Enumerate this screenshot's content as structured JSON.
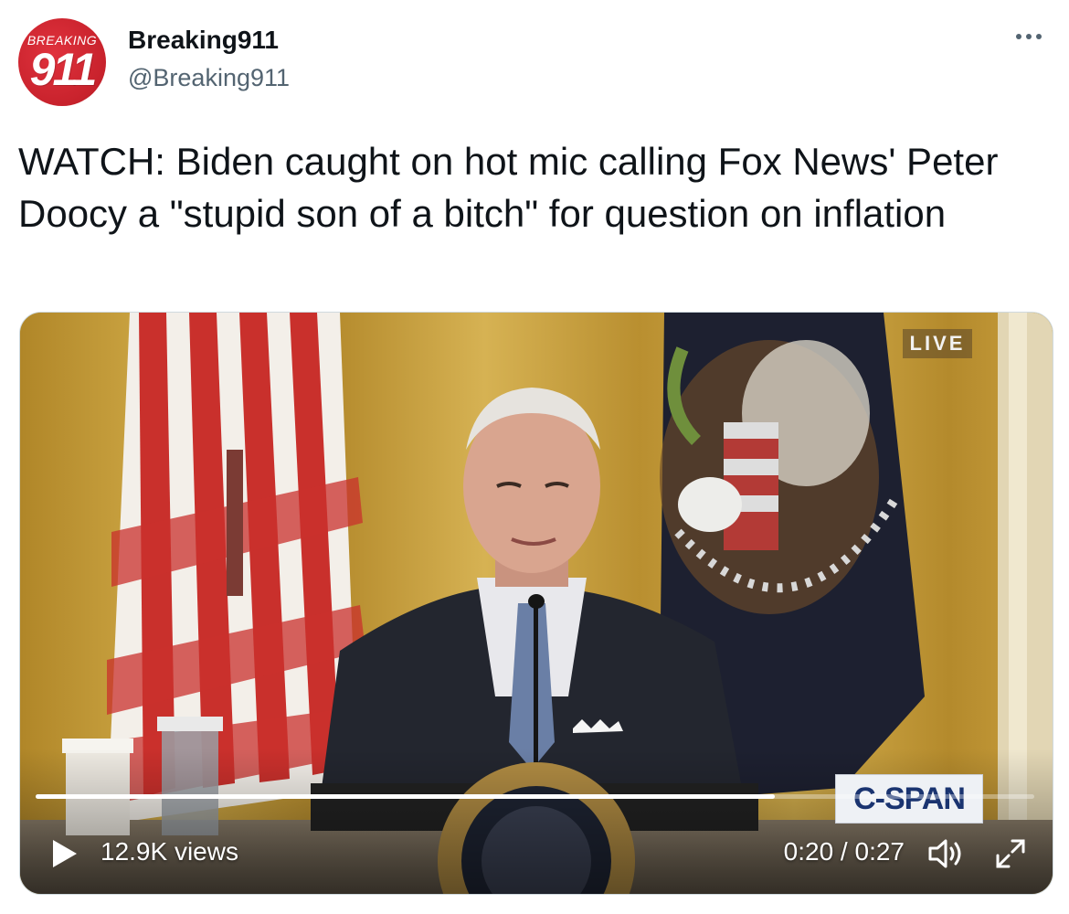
{
  "account": {
    "avatar_top_text": "BREAKING",
    "avatar_number": "911",
    "display_name": "Breaking911",
    "handle": "@Breaking911"
  },
  "tweet": {
    "text": "WATCH: Biden caught on hot mic calling Fox News' Peter Doocy a \"stupid son of a bitch\" for question on inflation"
  },
  "video": {
    "live_badge": "LIVE",
    "network_logo": "C-SPAN",
    "views": "12.9K views",
    "time": "0:20 / 0:27",
    "progress": 0.74,
    "controls": {
      "play_icon": "play-icon",
      "volume_icon": "volume-icon",
      "fullscreen_icon": "fullscreen-icon"
    }
  },
  "colors": {
    "text_primary": "#0f1419",
    "text_secondary": "#536471",
    "avatar_red": "#c8222c",
    "curtain_gold": "#c9a23c"
  }
}
